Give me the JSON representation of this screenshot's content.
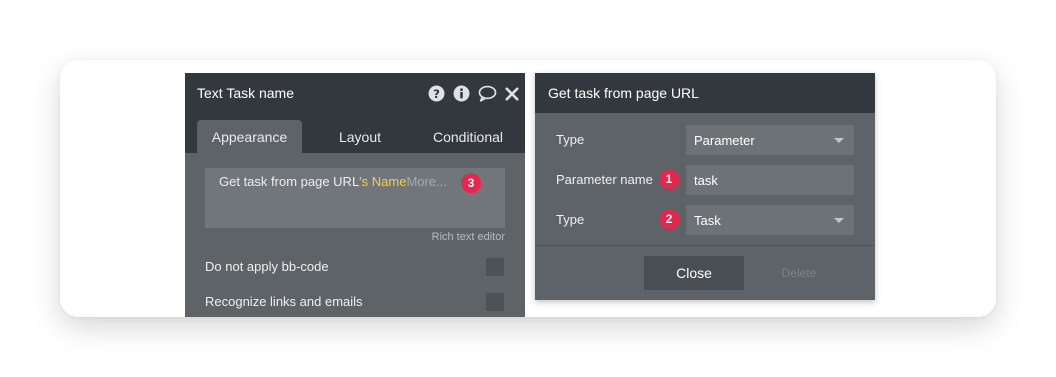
{
  "left_panel": {
    "title": "Text Task name",
    "tabs": [
      {
        "label": "Appearance",
        "active": true
      },
      {
        "label": "Layout",
        "active": false
      },
      {
        "label": "Conditional",
        "active": false
      }
    ],
    "text_editor": {
      "expression_source": "Get task from page URL",
      "expression_field": "'s Name",
      "more_label": "More...",
      "badge": "3"
    },
    "rich_text_label": "Rich text editor",
    "options": [
      {
        "label": "Do not apply bb-code",
        "checked": false
      },
      {
        "label": "Recognize links and emails",
        "checked": false
      }
    ],
    "header_icons": [
      "help-icon",
      "info-icon",
      "comment-icon",
      "close-icon"
    ]
  },
  "right_panel": {
    "title": "Get task from page URL",
    "rows": [
      {
        "label": "Type",
        "value": "Parameter",
        "kind": "dropdown",
        "badge": ""
      },
      {
        "label": "Parameter name",
        "value": "task",
        "kind": "text",
        "badge": "1"
      },
      {
        "label": "Type",
        "value": "Task",
        "kind": "dropdown",
        "badge": "2"
      }
    ],
    "close_label": "Close",
    "delete_label": "Delete"
  },
  "colors": {
    "header": "#32383d",
    "panel": "#5e6368",
    "field": "#6d7277",
    "badge": "#e8264b",
    "dynamic_text": "#f7ce43"
  }
}
